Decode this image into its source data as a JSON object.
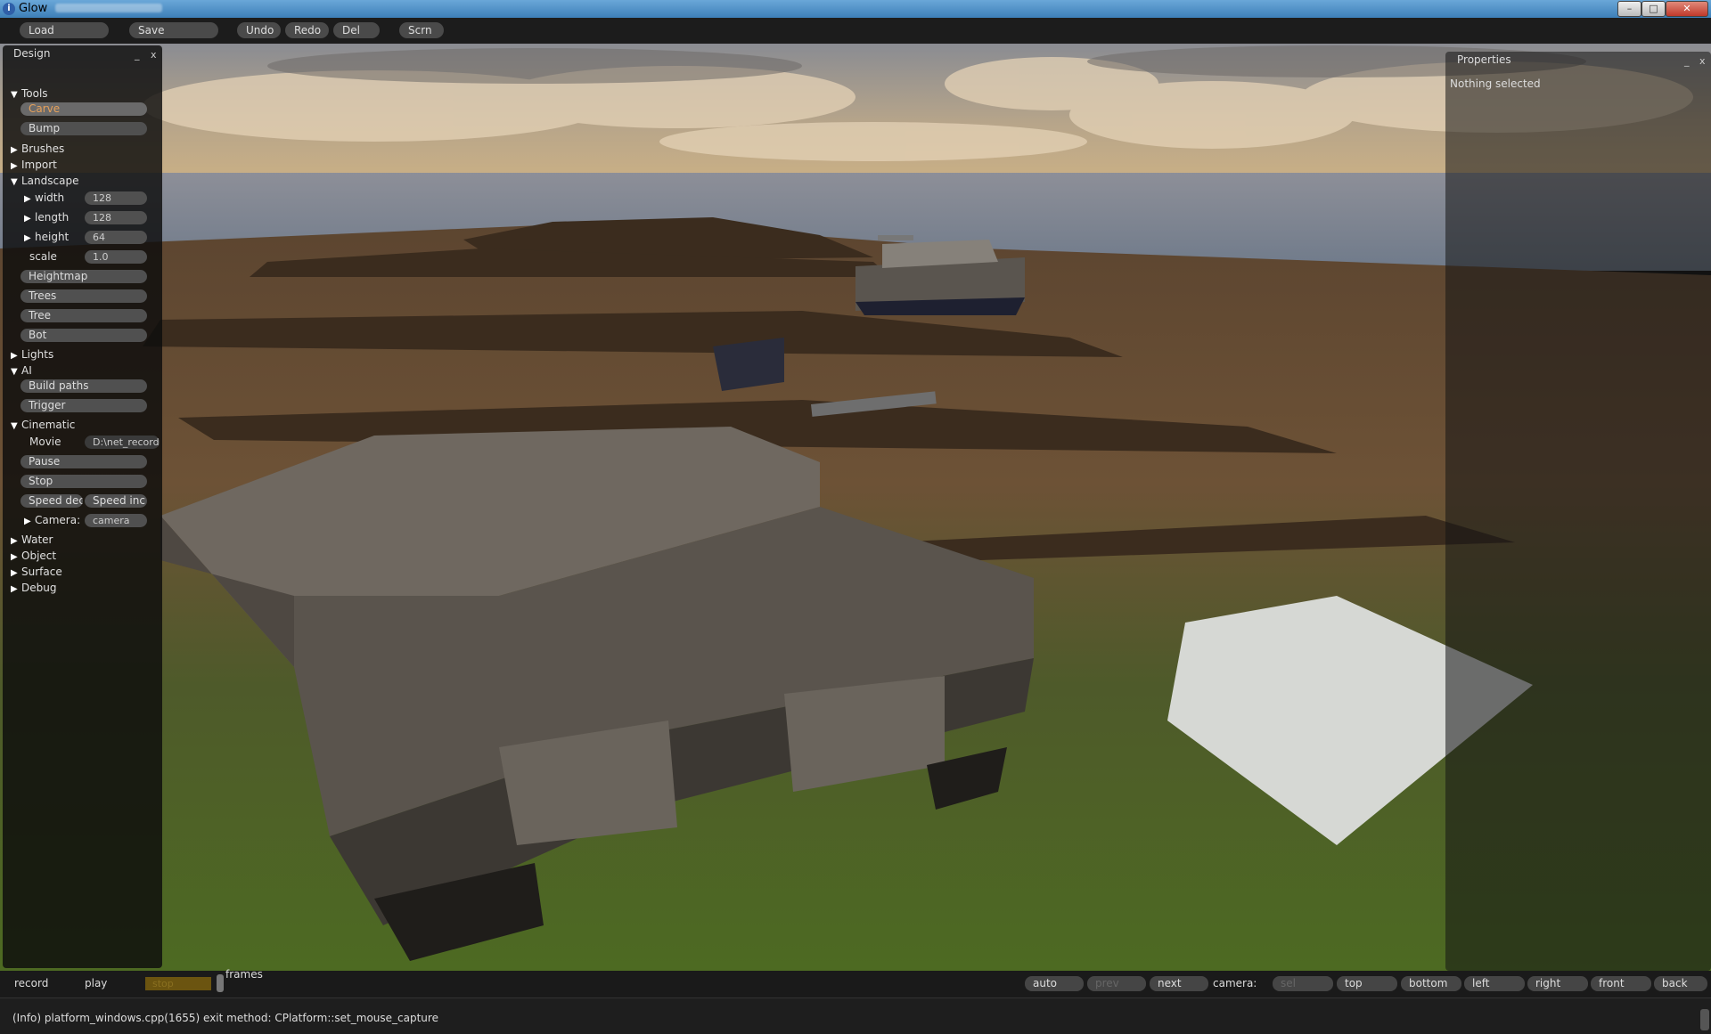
{
  "window": {
    "title": "Glow",
    "controls": {
      "minimize": "–",
      "maximize": "□",
      "close": "✕"
    }
  },
  "toolbar": {
    "load": "Load",
    "save": "Save",
    "undo": "Undo",
    "redo": "Redo",
    "del": "Del",
    "scrn": "Scrn"
  },
  "design_panel": {
    "title": "Design",
    "minimize": "_",
    "close": "x",
    "tools": {
      "label": "Tools",
      "carve": "Carve",
      "bump": "Bump"
    },
    "brushes": "Brushes",
    "import": "Import",
    "landscape": {
      "label": "Landscape",
      "width_label": "width",
      "width_value": "128",
      "length_label": "length",
      "length_value": "128",
      "height_label": "height",
      "height_value": "64",
      "scale_label": "scale",
      "scale_value": "1.0",
      "heightmap": "Heightmap",
      "trees": "Trees",
      "tree": "Tree",
      "bot": "Bot"
    },
    "lights": "Lights",
    "ai": {
      "label": "AI",
      "build_paths": "Build paths",
      "trigger": "Trigger"
    },
    "cinematic": {
      "label": "Cinematic",
      "movie_label": "Movie",
      "movie_value": "D:\\net_record.glw",
      "pause": "Pause",
      "stop": "Stop",
      "speed_dec": "Speed dec",
      "speed_inc": "Speed inc",
      "camera_label": "Camera:",
      "camera_value": "camera"
    },
    "water": "Water",
    "object": "Object",
    "surface": "Surface",
    "debug": "Debug"
  },
  "properties_panel": {
    "title": "Properties",
    "minimize": "_",
    "close": "x",
    "status": "Nothing selected"
  },
  "bottom_bar": {
    "record": "record",
    "play": "play",
    "stop": "stop",
    "frames": "frames",
    "auto": "auto",
    "prev": "prev",
    "next": "next",
    "camera_label": "camera:",
    "sel": "sel",
    "top": "top",
    "bottom": "bottom",
    "left": "left",
    "right": "right",
    "front": "front",
    "back": "back"
  },
  "status": {
    "message": "(Info) platform_windows.cpp(1655) exit method: CPlatform::set_mouse_capture"
  }
}
